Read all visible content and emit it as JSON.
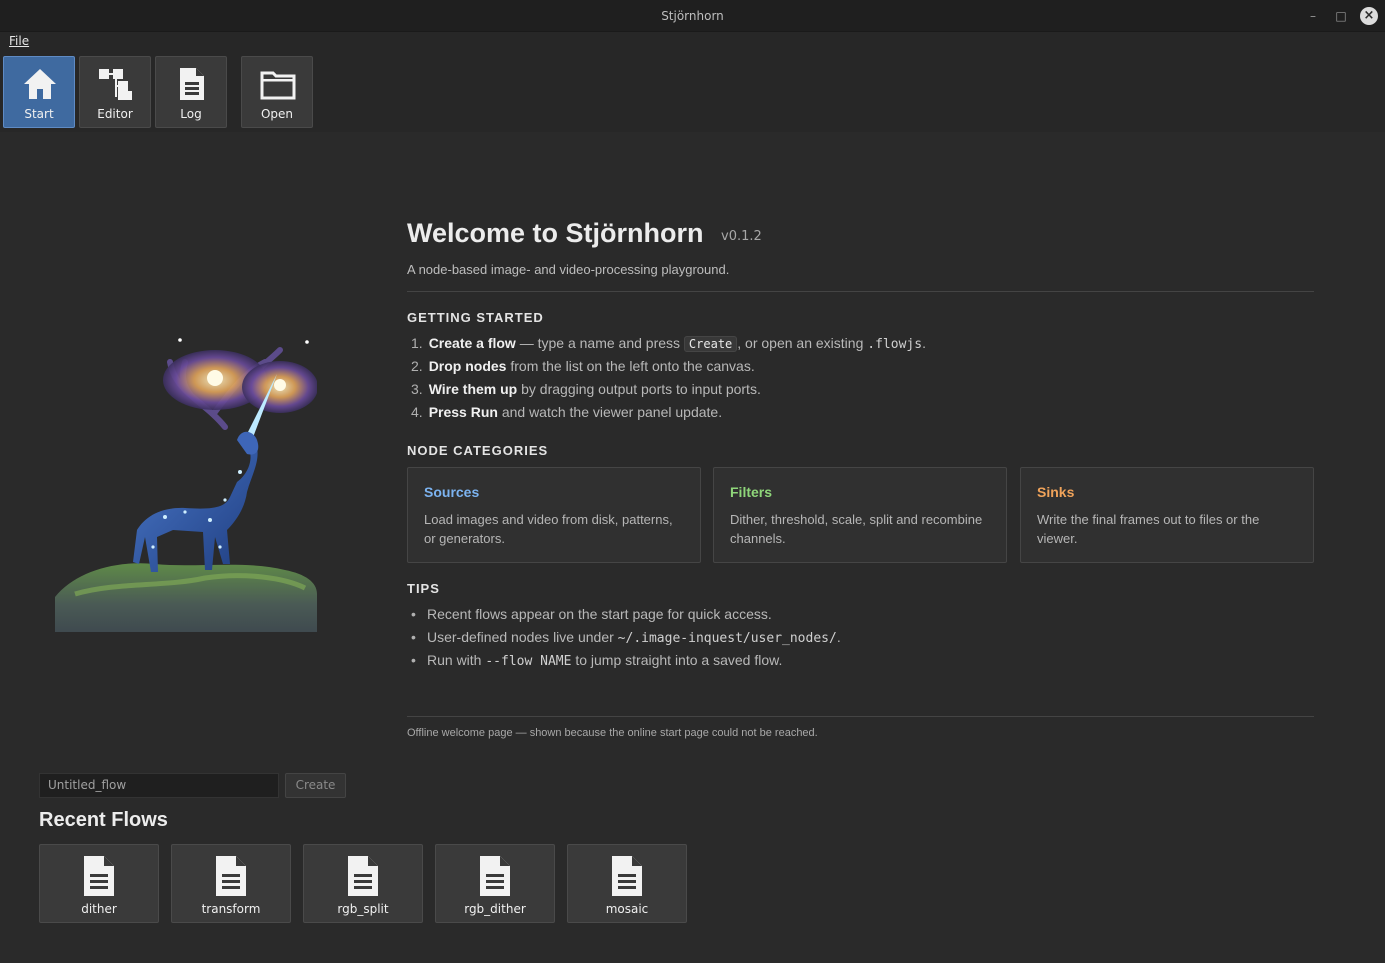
{
  "window": {
    "title": "Stjörnhorn"
  },
  "menu": {
    "file": "File"
  },
  "toolbar": [
    {
      "label": "Start",
      "icon": "home-icon",
      "active": true
    },
    {
      "label": "Editor",
      "icon": "node-editor-icon",
      "active": false
    },
    {
      "label": "Log",
      "icon": "document-icon",
      "active": false
    },
    {
      "label": "Open",
      "icon": "folder-icon",
      "active": false
    }
  ],
  "welcome": {
    "title": "Welcome to Stjörnhorn",
    "version": "v0.1.2",
    "subtitle": "A node-based image- and video-processing playground.",
    "getting_started_heading": "GETTING STARTED",
    "steps": [
      {
        "num": "1.",
        "bold": "Create a flow",
        "text1": " — type a name and press ",
        "kbd": "Create",
        "text2": ", or open an existing ",
        "code": ".flowjs",
        "text3": "."
      },
      {
        "num": "2.",
        "bold": "Drop nodes",
        "text": " from the list on the left onto the canvas."
      },
      {
        "num": "3.",
        "bold": "Wire them up",
        "text": " by dragging output ports to input ports."
      },
      {
        "num": "4.",
        "bold": "Press Run",
        "text": " and watch the viewer panel update."
      }
    ],
    "categories_heading": "NODE CATEGORIES",
    "categories": [
      {
        "name": "Sources",
        "desc": "Load images and video from disk, patterns, or generators.",
        "color": "#7cb3f0"
      },
      {
        "name": "Filters",
        "desc": "Dither, threshold, scale, split and recombine channels.",
        "color": "#8fd67a"
      },
      {
        "name": "Sinks",
        "desc": "Write the final frames out to files or the viewer.",
        "color": "#f0a35a"
      }
    ],
    "tips_heading": "TIPS",
    "tips": {
      "t1": "Recent flows appear on the start page for quick access.",
      "t2a": "User-defined nodes live under ",
      "t2code": "~/.image-inquest/user_nodes/",
      "t2b": ".",
      "t3a": "Run with ",
      "t3code": "--flow NAME",
      "t3b": " to jump straight into a saved flow."
    },
    "footnote": "Offline welcome page — shown because the online start page could not be reached."
  },
  "new_flow": {
    "value": "Untitled_flow",
    "create_label": "Create"
  },
  "recent": {
    "title": "Recent Flows",
    "flows": [
      "dither",
      "transform",
      "rgb_split",
      "rgb_dither",
      "mosaic"
    ]
  }
}
